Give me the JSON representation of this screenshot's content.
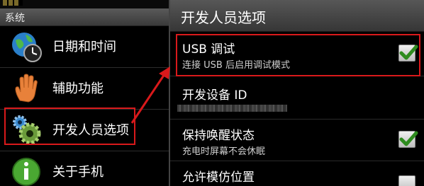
{
  "left_panel": {
    "section_header": "系统",
    "items": [
      {
        "label": "日期和时间",
        "icon": "globe-clock-icon"
      },
      {
        "label": "辅助功能",
        "icon": "hand-icon"
      },
      {
        "label": "开发人员选项",
        "icon": "gears-icon"
      },
      {
        "label": "关于手机",
        "icon": "info-icon"
      }
    ]
  },
  "right_panel": {
    "title": "开发人员选项",
    "items": [
      {
        "title": "USB 调试",
        "subtitle": "连接 USB 后启用调试模式",
        "checked": true
      },
      {
        "title": "开发设备 ID",
        "subtitle": ""
      },
      {
        "title": "保持唤醒状态",
        "subtitle": "充电时屏幕不会休眠",
        "checked": true
      },
      {
        "title": "允许模仿位置",
        "checked": false
      }
    ]
  },
  "colors": {
    "highlight": "#d9191b",
    "check_green": "#2e8b1e"
  }
}
